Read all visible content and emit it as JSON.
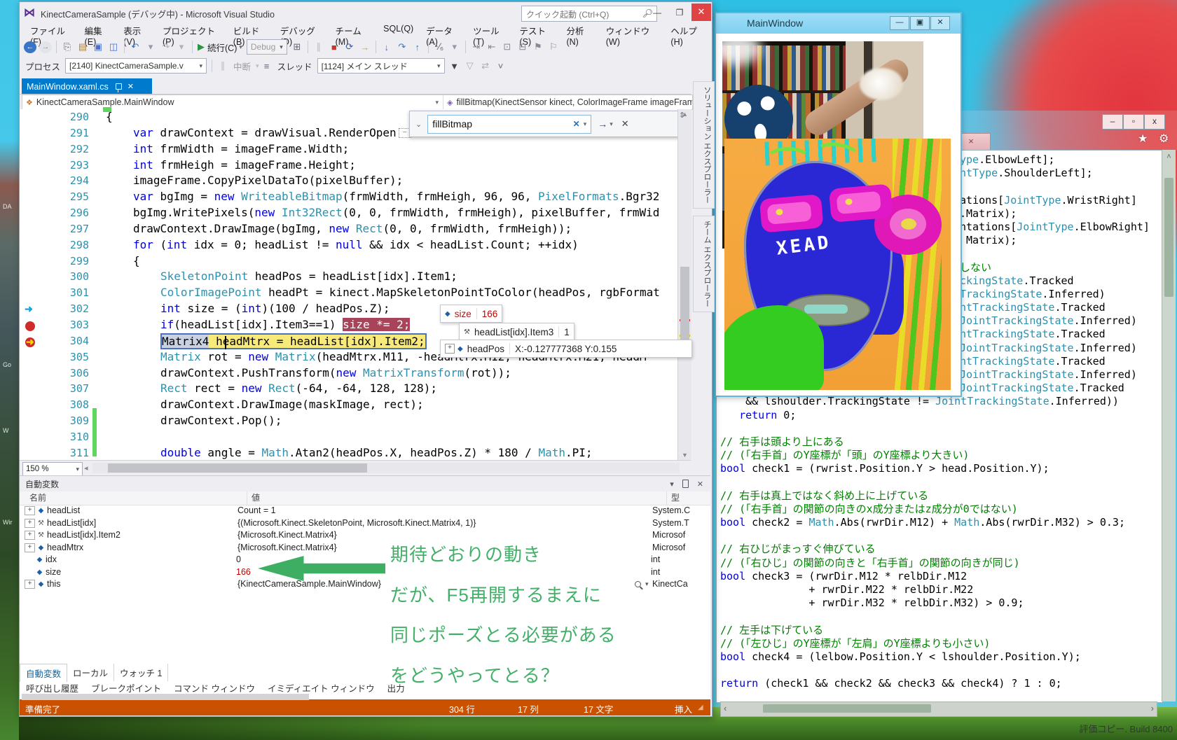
{
  "desktop": {
    "watermark": "評価コピー. Build 8400",
    "edge_labels": [
      "DA",
      "Go",
      "W",
      "Wir"
    ]
  },
  "vs": {
    "title": "KinectCameraSample (デバッグ中) - Microsoft Visual Studio",
    "quick_launch_placeholder": "クイック起動 (Ctrl+Q)",
    "menus": [
      "ファイル(F)",
      "編集(E)",
      "表示(V)",
      "プロジェクト(P)",
      "ビルド(B)",
      "デバッグ(D)",
      "チーム(M)",
      "SQL(Q)",
      "データ(A)",
      "ツール(T)",
      "テスト(S)",
      "分析(N)",
      "ウィンドウ(W)",
      "ヘルプ(H)"
    ],
    "toolbar": {
      "continue_label": "続行(C)",
      "debug_combo": "Debug",
      "icons_a": [
        {
          "n": "navigate-backward-icon",
          "g": "←",
          "c": "#ffffff",
          "bg": "#3a76c8",
          "round": true
        },
        {
          "n": "navigate-forward-icon",
          "g": "→",
          "c": "#8a8f9a",
          "bg": "#e2e4ea",
          "round": true
        },
        {
          "sep": true
        },
        {
          "n": "new-file-icon",
          "g": "⎘",
          "c": "#667"
        },
        {
          "n": "open-file-icon",
          "g": "▤",
          "c": "#a9824c"
        },
        {
          "n": "save-icon",
          "g": "▣",
          "c": "#4a6fd0"
        },
        {
          "n": "save-all-icon",
          "g": "◫",
          "c": "#4a6fd0"
        },
        {
          "sep": true
        },
        {
          "n": "undo-icon",
          "g": "↶",
          "c": "#3a76c8"
        },
        {
          "n": "undo-caret-icon",
          "g": "▾",
          "c": "#99a"
        },
        {
          "n": "redo-icon",
          "g": "↷",
          "c": "#b0b3ba"
        },
        {
          "n": "redo-caret-icon",
          "g": "▾",
          "c": "#b0b3ba"
        },
        {
          "sep": true
        }
      ],
      "icons_b": [
        {
          "n": "debug-windows-icon",
          "g": "⊞",
          "c": "#667"
        },
        {
          "sep": true
        },
        {
          "n": "pause-icon",
          "g": "∥",
          "c": "#b9bcc2"
        },
        {
          "n": "stop-icon",
          "g": "■",
          "c": "#c03a30"
        },
        {
          "n": "restart-icon",
          "g": "⟳",
          "c": "#3a5fa8"
        },
        {
          "n": "show-next-statement-icon",
          "g": "→",
          "c": "#d8a020"
        },
        {
          "sep": true
        },
        {
          "n": "step-into-icon",
          "g": "↓",
          "c": "#3a76c8"
        },
        {
          "n": "step-over-icon",
          "g": "↷",
          "c": "#3a76c8"
        },
        {
          "n": "step-out-icon",
          "g": "↑",
          "c": "#3a76c8"
        },
        {
          "sep": true
        },
        {
          "n": "hex-display-icon",
          "g": "⅟₆",
          "c": "#667"
        },
        {
          "n": "hex-caret-icon",
          "g": "▾",
          "c": "#99a"
        },
        {
          "sep": true
        },
        {
          "n": "indent-icon",
          "g": "⇥",
          "c": "#889"
        },
        {
          "n": "outdent-icon",
          "g": "⇤",
          "c": "#889"
        },
        {
          "n": "comment-icon",
          "g": "⊡",
          "c": "#889"
        },
        {
          "n": "uncomment-icon",
          "g": "⊟",
          "c": "#889"
        },
        {
          "n": "bookmark-icon",
          "g": "⚑",
          "c": "#889"
        },
        {
          "n": "bookmark-next-icon",
          "g": "⚐",
          "c": "#889"
        }
      ],
      "process_label": "プロセス",
      "process_value": "[2140] KinectCameraSample.v",
      "break_label": "中断",
      "thread_label": "スレッド",
      "thread_value": "[1124] メイン スレッド",
      "icons_c": [
        {
          "n": "filter-icon",
          "g": "▼",
          "c": "#444"
        },
        {
          "n": "filter-clear-icon",
          "g": "▽",
          "c": "#aab"
        },
        {
          "n": "flag-threads-icon",
          "g": "⇄",
          "c": "#aab"
        },
        {
          "n": "overflow-icon",
          "g": "˅",
          "c": "#667"
        }
      ]
    },
    "doc_tab": "MainWindow.xaml.cs",
    "nav_left": "KinectCameraSample.MainWindow",
    "nav_right": "fillBitmap(KinectSensor kinect, ColorImageFrame imageFrame, List<Tuple<",
    "search_value": "fillBitmap",
    "zoom_value": "150 %",
    "code_lines": [
      {
        "n": 290,
        "i": 10,
        "t": [
          [
            "p",
            "{"
          ]
        ]
      },
      {
        "n": 291,
        "i": 49,
        "t": [
          [
            "k",
            "var"
          ],
          [
            "p",
            " drawContext = drawVisual.RenderOpen"
          ]
        ],
        "dots": true
      },
      {
        "n": 292,
        "i": 49,
        "t": [
          [
            "k",
            "int"
          ],
          [
            "p",
            " frmWidth = imageFrame.Width;"
          ]
        ]
      },
      {
        "n": 293,
        "i": 49,
        "t": [
          [
            "k",
            "int"
          ],
          [
            "p",
            " frmHeigh = imageFrame.Height;"
          ]
        ]
      },
      {
        "n": 294,
        "i": 49,
        "t": [
          [
            "p",
            "imageFrame.CopyPixelDataTo(pixelBuffer);"
          ]
        ]
      },
      {
        "n": 295,
        "i": 49,
        "t": [
          [
            "k",
            "var"
          ],
          [
            "p",
            " bgImg = "
          ],
          [
            "k",
            "new"
          ],
          [
            "t",
            " WriteableBitmap"
          ],
          [
            "p",
            "(frmWidth, frmHeigh, 96, 96, "
          ],
          [
            "t",
            "PixelFormats"
          ],
          [
            "p",
            ".Bgr32"
          ]
        ]
      },
      {
        "n": 296,
        "i": 49,
        "t": [
          [
            "p",
            "bgImg.WritePixels("
          ],
          [
            "k",
            "new"
          ],
          [
            "t",
            " Int32Rect"
          ],
          [
            "p",
            "(0, 0, frmWidth, frmHeigh), pixelBuffer, frmWid"
          ]
        ]
      },
      {
        "n": 297,
        "i": 49,
        "t": [
          [
            "p",
            "drawContext.DrawImage(bgImg, "
          ],
          [
            "k",
            "new"
          ],
          [
            "t",
            " Rect"
          ],
          [
            "p",
            "(0, 0, frmWidth, frmHeigh));"
          ]
        ]
      },
      {
        "n": 298,
        "i": 49,
        "t": [
          [
            "k",
            "for"
          ],
          [
            "p",
            " ("
          ],
          [
            "k",
            "int"
          ],
          [
            "p",
            " idx = 0; headList != "
          ],
          [
            "k",
            "null"
          ],
          [
            "p",
            " && idx < headList.Count; ++idx)"
          ]
        ]
      },
      {
        "n": 299,
        "i": 49,
        "t": [
          [
            "p",
            "{"
          ]
        ]
      },
      {
        "n": 300,
        "i": 88,
        "t": [
          [
            "t",
            "SkeletonPoint"
          ],
          [
            "p",
            " headPos = headList[idx].Item1;"
          ]
        ]
      },
      {
        "n": 301,
        "i": 88,
        "t": [
          [
            "t",
            "ColorImagePoint"
          ],
          [
            "p",
            " headPt = kinect.MapSkeletonPointToColor(headPos, rgbFormat"
          ]
        ]
      },
      {
        "n": 302,
        "i": 88,
        "t": [
          [
            "k",
            "int"
          ],
          [
            "p",
            " size = ("
          ],
          [
            "k",
            "int"
          ],
          [
            "p",
            ")(100 / headPos.Z);"
          ]
        ]
      },
      {
        "n": 303,
        "i": 88,
        "t": [
          [
            "k",
            "if"
          ],
          [
            "p",
            "(headList[idx].Item3==1) "
          ],
          [
            "hlr",
            "size *= 2;"
          ]
        ]
      },
      {
        "n": 304,
        "i": 88,
        "b": true,
        "t": [
          [
            "hlg",
            "Matrix4"
          ],
          [
            "hly",
            " headMtrx = headList[idx].Item2;"
          ]
        ]
      },
      {
        "n": 305,
        "i": 88,
        "t": [
          [
            "t",
            "Matrix"
          ],
          [
            "p",
            " rot = "
          ],
          [
            "k",
            "new"
          ],
          [
            "t",
            " Matrix"
          ],
          [
            "p",
            "(headMtrx.M11, -headMtrx.M12, headMtrx.M21, headM"
          ]
        ]
      },
      {
        "n": 306,
        "i": 88,
        "t": [
          [
            "p",
            "drawContext.PushTransform("
          ],
          [
            "k",
            "new"
          ],
          [
            "t",
            " MatrixTransform"
          ],
          [
            "p",
            "(rot));"
          ]
        ]
      },
      {
        "n": 307,
        "i": 88,
        "t": [
          [
            "t",
            "Rect"
          ],
          [
            "p",
            " rect = "
          ],
          [
            "k",
            "new"
          ],
          [
            "t",
            " Rect"
          ],
          [
            "p",
            "(-64, -64, 128, 128);"
          ]
        ]
      },
      {
        "n": 308,
        "i": 88,
        "t": [
          [
            "p",
            "drawContext.DrawImage(maskImage, rect);"
          ]
        ]
      },
      {
        "n": 309,
        "i": 88,
        "t": [
          [
            "p",
            "drawContext.Pop();"
          ]
        ]
      },
      {
        "n": 310,
        "i": 0,
        "t": []
      },
      {
        "n": 311,
        "i": 88,
        "t": [
          [
            "k",
            "double"
          ],
          [
            "p",
            " angle = "
          ],
          [
            "t",
            "Math"
          ],
          [
            "p",
            ".Atan2(headPos.X, headPos.Z) * 180 / "
          ],
          [
            "t",
            "Math"
          ],
          [
            "p",
            ".PI;"
          ]
        ]
      }
    ],
    "datatips": {
      "size": {
        "name": "size",
        "value": "166"
      },
      "item3": {
        "name": "headList[idx].Item3",
        "value": "1"
      },
      "headpos": {
        "name": "headPos",
        "value": "X:-0.127777368 Y:0.155"
      }
    },
    "autos": {
      "title": "自動変数",
      "columns": [
        "名前",
        "値",
        "型"
      ],
      "rows": [
        {
          "e": true,
          "icon": "field",
          "name": "headList",
          "value": "Count = 1",
          "type": "System.C"
        },
        {
          "e": true,
          "icon": "wrench",
          "name": "headList[idx]",
          "value": "{(Microsoft.Kinect.SkeletonPoint, Microsoft.Kinect.Matrix4, 1)}",
          "type": "System.T"
        },
        {
          "e": true,
          "icon": "wrench",
          "name": "headList[idx].Item2",
          "value": "{Microsoft.Kinect.Matrix4}",
          "type": "Microsof"
        },
        {
          "e": true,
          "icon": "field",
          "name": "headMtrx",
          "value": "{Microsoft.Kinect.Matrix4}",
          "type": "Microsof"
        },
        {
          "e": false,
          "icon": "field",
          "name": "idx",
          "value": "0",
          "type": "int"
        },
        {
          "e": false,
          "icon": "field",
          "name": "size",
          "value": "166",
          "red": true,
          "type": "int"
        },
        {
          "e": true,
          "icon": "field",
          "name": "this",
          "value": "{KinectCameraSample.MainWindow}",
          "type": "KinectCa",
          "mag": true
        }
      ]
    },
    "bottom_tabs1": [
      "自動変数",
      "ローカル",
      "ウォッチ 1"
    ],
    "bottom_tabs2": [
      "呼び出し履歴",
      "ブレークポイント",
      "コマンド ウィンドウ",
      "イミディエイト ウィンドウ",
      "出力"
    ],
    "status": {
      "ready": "準備完了",
      "line": "304 行",
      "col": "17 列",
      "ch": "17 文字",
      "mode": "挿入"
    },
    "right_tabs": [
      "ソリューション エクスプローラー",
      "チーム エクスプローラー"
    ]
  },
  "main_window": {
    "title": "MainWindow",
    "face_label": "XEAD"
  },
  "code_window": {
    "lines": [
      {
        "t": [
          [
            "t",
            "ype"
          ],
          [
            "p",
            ".ElbowLeft];"
          ]
        ]
      },
      {
        "t": [
          [
            "t",
            "ntType"
          ],
          [
            "p",
            ".ShoulderLeft];"
          ]
        ]
      },
      {
        "t": []
      },
      {
        "t": [
          [
            "p",
            "ations["
          ],
          [
            "t",
            "JointType"
          ],
          [
            "p",
            ".WristRight]"
          ]
        ]
      },
      {
        "t": [
          [
            "p",
            ".Matrix);"
          ]
        ]
      },
      {
        "t": [
          [
            "p",
            "ntations["
          ],
          [
            "t",
            "JointType"
          ],
          [
            "p",
            ".ElbowRight]"
          ]
        ]
      },
      {
        "t": [
          [
            "p",
            " Matrix);"
          ]
        ]
      },
      {
        "t": []
      },
      {
        "t": [
          [
            "c",
            "しない"
          ]
        ]
      },
      {
        "t": [
          [
            "t",
            "ckingState"
          ],
          [
            "p",
            ".Tracked"
          ]
        ]
      },
      {
        "t": [
          [
            "t",
            "TrackingState"
          ],
          [
            "p",
            ".Inferred)"
          ]
        ]
      },
      {
        "t": [
          [
            "t",
            "ntTrackingState"
          ],
          [
            "p",
            ".Tracked"
          ]
        ]
      },
      {
        "t": [
          [
            "t",
            "JointTrackingState"
          ],
          [
            "p",
            ".Inferred)"
          ]
        ]
      },
      {
        "t": [
          [
            "t",
            "ntTrackingState"
          ],
          [
            "p",
            ".Tracked"
          ]
        ]
      },
      {
        "t": [
          [
            "t",
            "JointTrackingState"
          ],
          [
            "p",
            ".Inferred)"
          ]
        ]
      },
      {
        "t": [
          [
            "t",
            "ntTrackingState"
          ],
          [
            "p",
            ".Tracked"
          ]
        ]
      },
      {
        "t": [
          [
            "t",
            "JointTrackingState"
          ],
          [
            "p",
            ".Inferred)"
          ]
        ]
      },
      {
        "t": [
          [
            "t",
            "JointTrackingState"
          ],
          [
            "p",
            ".Tracked"
          ]
        ]
      },
      {
        "t": [
          [
            "p",
            "    && lshoulder.TrackingState != "
          ],
          [
            "t",
            "JointTrackingState"
          ],
          [
            "p",
            ".Inferred))"
          ]
        ]
      },
      {
        "t": [
          [
            "p",
            "   "
          ],
          [
            "k",
            "return"
          ],
          [
            "p",
            " 0;"
          ]
        ]
      },
      {
        "t": []
      },
      {
        "t": [
          [
            "c",
            "// 右手は頭より上にある"
          ]
        ]
      },
      {
        "t": [
          [
            "c",
            "// (「右手首」のY座標が「頭」のY座標より大きい)"
          ]
        ]
      },
      {
        "t": [
          [
            "k",
            "bool"
          ],
          [
            "p",
            " check1 = (rwrist.Position.Y > head.Position.Y);"
          ]
        ]
      },
      {
        "t": []
      },
      {
        "t": [
          [
            "c",
            "// 右手は真上ではなく斜め上に上げている"
          ]
        ]
      },
      {
        "t": [
          [
            "c",
            "// (「右手首」の関節の向きのx成分またはz成分が0ではない)"
          ]
        ]
      },
      {
        "t": [
          [
            "k",
            "bool"
          ],
          [
            "p",
            " check2 = "
          ],
          [
            "t",
            "Math"
          ],
          [
            "p",
            ".Abs(rwrDir.M12) + "
          ],
          [
            "t",
            "Math"
          ],
          [
            "p",
            ".Abs(rwrDir.M32) > 0.3;"
          ]
        ]
      },
      {
        "t": []
      },
      {
        "t": [
          [
            "c",
            "// 右ひじがまっすぐ伸びている"
          ]
        ]
      },
      {
        "t": [
          [
            "c",
            "// (「右ひじ」の関節の向きと「右手首」の関節の向きが同じ)"
          ]
        ]
      },
      {
        "t": [
          [
            "k",
            "bool"
          ],
          [
            "p",
            " check3 = (rwrDir.M12 * relbDir.M12"
          ]
        ]
      },
      {
        "t": [
          [
            "p",
            "              + rwrDir.M22 * relbDir.M22"
          ]
        ]
      },
      {
        "t": [
          [
            "p",
            "              + rwrDir.M32 * relbDir.M32) > 0.9;"
          ]
        ]
      },
      {
        "t": []
      },
      {
        "t": [
          [
            "c",
            "// 左手は下げている"
          ]
        ]
      },
      {
        "t": [
          [
            "c",
            "// (「左ひじ」のY座標が「左肩」のY座標よりも小さい)"
          ]
        ]
      },
      {
        "t": [
          [
            "k",
            "bool"
          ],
          [
            "p",
            " check4 = (lelbow.Position.Y < lshoulder.Position.Y);"
          ]
        ]
      },
      {
        "t": []
      },
      {
        "t": [
          [
            "k",
            "return"
          ],
          [
            "p",
            " (check1 && check2 && check3 && check4) ? 1 : 0;"
          ]
        ]
      }
    ]
  },
  "annotations": {
    "lines": [
      "期待どおりの動き",
      "だが、F5再開するまえに",
      "同じポーズとる必要がある",
      "をどうやってとる？"
    ]
  }
}
